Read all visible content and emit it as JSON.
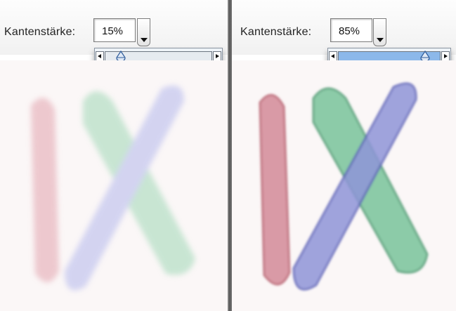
{
  "panels": [
    {
      "id": "left",
      "edge_label": "Kantenstärke:",
      "edge_value": "15%",
      "slider_fraction": 0.15,
      "stroke_edge_strength": 0.15
    },
    {
      "id": "right",
      "edge_label": "Kantenstärke:",
      "edge_value": "85%",
      "slider_fraction": 0.85,
      "stroke_edge_strength": 0.85
    }
  ],
  "icons": {
    "stepper": "chevron-down-icon",
    "slider_left": "arrow-left-icon",
    "slider_right": "arrow-right-icon",
    "thumb": "slider-thumb-icon"
  },
  "colors": {
    "stroke_red": "#d48a98",
    "stroke_green": "#78c49a",
    "stroke_blue": "#8f95d8",
    "slider_fill": "#8cb8ea"
  }
}
